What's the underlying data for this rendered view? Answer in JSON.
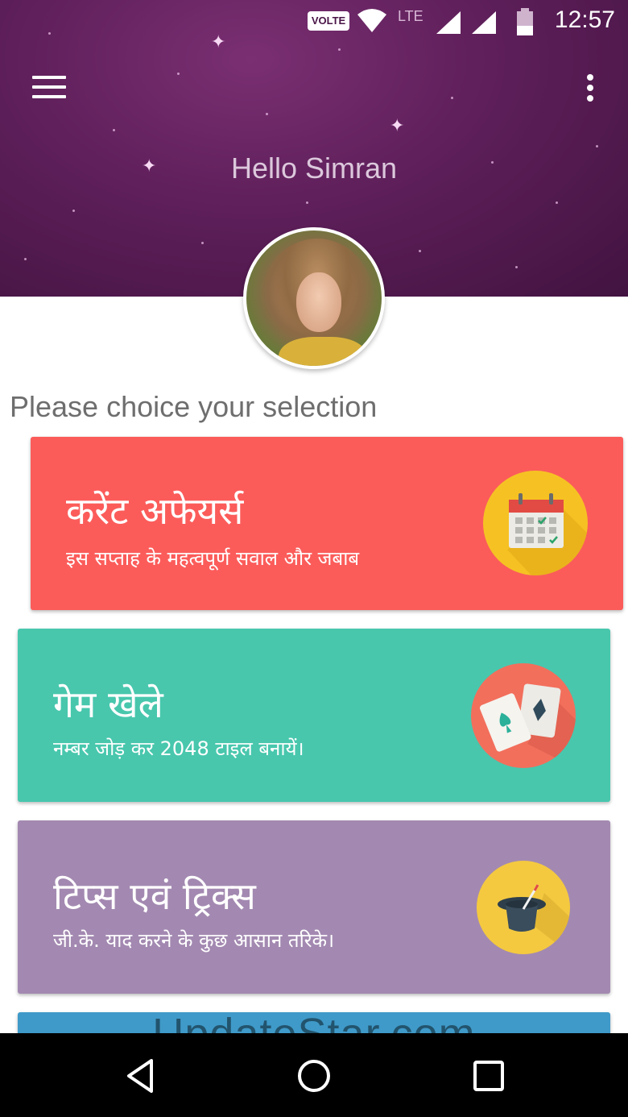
{
  "status_bar": {
    "volte_label": "VOLTE",
    "network_label": "LTE",
    "time": "12:57"
  },
  "header": {
    "greeting": "Hello Simran",
    "menu_icon": "hamburger-menu-icon",
    "overflow_icon": "more-vert-icon"
  },
  "main": {
    "section_title": "Please choice your selection",
    "cards": [
      {
        "title": "करेंट अफेयर्स",
        "subtitle": "इस सप्ताह के महत्वपूर्ण सवाल और जबाब",
        "icon": "calendar-icon",
        "color": "#fb5c5a"
      },
      {
        "title": "गेम खेले",
        "subtitle": "नम्बर जोड़ कर 2048 टाइल बनायें।",
        "icon": "playing-cards-icon",
        "color": "#48c7ad"
      },
      {
        "title": "टिप्स एवं ट्रिक्स",
        "subtitle": "जी.के. याद करने के कुछ आसान तरिके।",
        "icon": "magic-hat-icon",
        "color": "#a389b1"
      },
      {
        "color": "#3f9ac9"
      }
    ]
  },
  "watermark": "UpdateStar.com",
  "navbar": {
    "back_icon": "back-triangle-icon",
    "home_icon": "home-circle-icon",
    "recents_icon": "recents-square-icon"
  }
}
